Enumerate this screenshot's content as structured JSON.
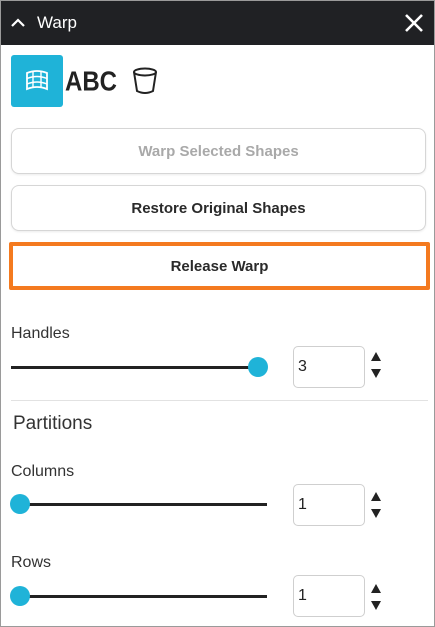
{
  "window": {
    "title": "Warp"
  },
  "toolbar": {
    "items": [
      {
        "icon": "warp-grid-icon",
        "active": true
      },
      {
        "icon": "warp-text-icon",
        "label": "ABC",
        "active": false
      },
      {
        "icon": "container-icon",
        "active": false
      }
    ]
  },
  "actions": {
    "warp_selected": "Warp Selected Shapes",
    "restore_original": "Restore Original Shapes",
    "release_warp": "Release Warp"
  },
  "handles": {
    "label": "Handles",
    "value": "3",
    "slider_fraction": 1.0
  },
  "partitions": {
    "heading": "Partitions",
    "columns": {
      "label": "Columns",
      "value": "1",
      "slider_fraction": 0.0
    },
    "rows": {
      "label": "Rows",
      "value": "1",
      "slider_fraction": 0.0
    }
  },
  "colors": {
    "accent": "#1fb3d8",
    "highlight": "#f47a1f",
    "titlebar": "#202124"
  }
}
